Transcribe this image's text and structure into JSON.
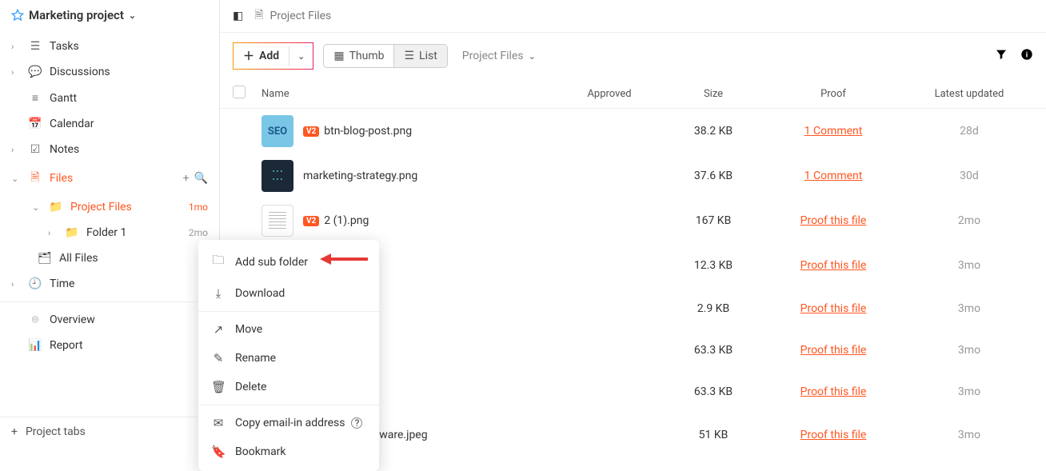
{
  "project": {
    "name": "Marketing project"
  },
  "sidebar": {
    "items": [
      {
        "label": "Tasks"
      },
      {
        "label": "Discussions"
      },
      {
        "label": "Gantt"
      },
      {
        "label": "Calendar"
      },
      {
        "label": "Notes"
      },
      {
        "label": "Files"
      },
      {
        "label": "Time"
      }
    ],
    "files_children": [
      {
        "label": "Project Files",
        "time": "1mo"
      },
      {
        "label": "Folder 1",
        "time": "2mo"
      },
      {
        "label": "All Files"
      }
    ],
    "secondary": [
      {
        "label": "Overview"
      },
      {
        "label": "Report"
      }
    ],
    "bottom": {
      "label": "Project tabs"
    }
  },
  "breadcrumb": {
    "label": "Project Files"
  },
  "toolbar": {
    "add_label": "Add",
    "thumb_label": "Thumb",
    "list_label": "List",
    "crumb_label": "Project Files"
  },
  "columns": {
    "name": "Name",
    "approved": "Approved",
    "size": "Size",
    "proof": "Proof",
    "updated": "Latest updated"
  },
  "files": [
    {
      "version": "V2",
      "name": "btn-blog-post.png",
      "approved": "",
      "size": "38.2 KB",
      "proof": "1 Comment",
      "updated": "28d"
    },
    {
      "version": "",
      "name": "marketing-strategy.png",
      "approved": "",
      "size": "37.6 KB",
      "proof": "1 Comment",
      "updated": "30d"
    },
    {
      "version": "V2",
      "name": "2 (1).png",
      "approved": "",
      "size": "167 KB",
      "proof": "Proof this file",
      "updated": "2mo"
    },
    {
      "version": "",
      "name": "",
      "approved": "",
      "size": "12.3 KB",
      "proof": "Proof this file",
      "updated": "3mo"
    },
    {
      "version": "",
      "name": "",
      "approved": "",
      "size": "2.9 KB",
      "proof": "Proof this file",
      "updated": "3mo"
    },
    {
      "version": "",
      "name": "",
      "approved": "",
      "size": "63.3 KB",
      "proof": "Proof this file",
      "updated": "3mo"
    },
    {
      "version": "",
      "name": "",
      "approved": "",
      "size": "63.3 KB",
      "proof": "Proof this file",
      "updated": "3mo"
    },
    {
      "version": "",
      "name": "nent-Tools-Software.jpeg",
      "approved": "",
      "size": "51 KB",
      "proof": "Proof this file",
      "updated": "3mo"
    }
  ],
  "context_menu": {
    "items": [
      {
        "label": "Add sub folder"
      },
      {
        "label": "Download"
      },
      {
        "label": "Move"
      },
      {
        "label": "Rename"
      },
      {
        "label": "Delete"
      },
      {
        "label": "Copy email-in address"
      },
      {
        "label": "Bookmark"
      }
    ]
  }
}
